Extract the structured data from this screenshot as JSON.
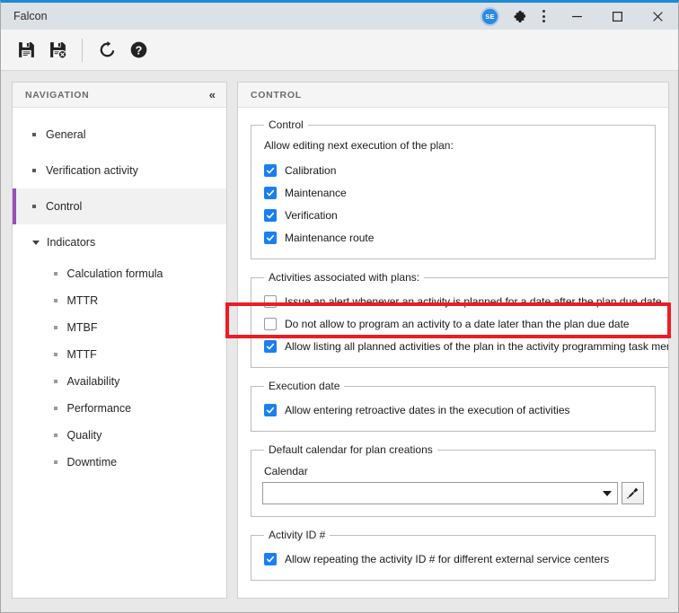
{
  "window": {
    "title": "Falcon",
    "avatar_initials": "SE",
    "accent_top": "#1c8ad4",
    "controls": {
      "minimize": "Minimize",
      "maximize": "Maximize",
      "close": "Close"
    },
    "extensions_icon": "puzzle-piece-icon",
    "menu_icon": "kebab-menu-icon"
  },
  "toolbar": {
    "items": [
      {
        "name": "save-button",
        "icon": "floppy-disk-icon",
        "tooltip": "Save"
      },
      {
        "name": "save-and-close-button",
        "icon": "floppy-disk-close-icon",
        "tooltip": "Save and close"
      },
      {
        "name": "refresh-button",
        "icon": "refresh-icon",
        "tooltip": "Refresh"
      },
      {
        "name": "help-button",
        "icon": "question-circle-icon",
        "tooltip": "Help"
      }
    ]
  },
  "sidebar": {
    "header": "NAVIGATION",
    "collapse_icon": "double-chevron-left-icon",
    "items": [
      {
        "label": "General",
        "type": "item",
        "selected": false
      },
      {
        "label": "Verification activity",
        "type": "item",
        "selected": false
      },
      {
        "label": "Control",
        "type": "item",
        "selected": true
      },
      {
        "label": "Indicators",
        "type": "group",
        "expanded": true
      }
    ],
    "sub_items": [
      {
        "label": "Calculation formula"
      },
      {
        "label": "MTTR"
      },
      {
        "label": "MTBF"
      },
      {
        "label": "MTTF"
      },
      {
        "label": "Availability"
      },
      {
        "label": "Performance"
      },
      {
        "label": "Quality"
      },
      {
        "label": "Downtime"
      }
    ],
    "selected_accent": "#9651b8"
  },
  "main": {
    "header": "CONTROL",
    "checkbox_accent": "#1a7ff0",
    "groups": [
      {
        "legend": "Control",
        "hint": "Allow editing next execution of the plan:",
        "checkboxes": [
          {
            "label": "Calibration",
            "checked": true
          },
          {
            "label": "Maintenance",
            "checked": true
          },
          {
            "label": "Verification",
            "checked": true
          },
          {
            "label": "Maintenance route",
            "checked": true
          }
        ]
      },
      {
        "legend": "Activities associated with plans:",
        "checkboxes": [
          {
            "label": "Issue an alert whenever an activity is planned for a date after the plan due date",
            "checked": false
          },
          {
            "label": "Do not allow to program an activity to a date later than the plan due date",
            "checked": false
          },
          {
            "label": "Allow listing all planned activities of the plan in the activity programming task menu.",
            "checked": true
          }
        ]
      },
      {
        "legend": "Execution date",
        "checkboxes": [
          {
            "label": "Allow entering retroactive dates in the execution of activities",
            "checked": true
          }
        ]
      },
      {
        "legend": "Default calendar for plan creations",
        "field_label": "Calendar",
        "select_value": "",
        "select_caret_icon": "chevron-down-icon",
        "clear_button_icon": "brush-icon"
      },
      {
        "legend": "Activity ID #",
        "checkboxes": [
          {
            "label": "Allow repeating the activity ID # for different external service centers",
            "checked": true
          }
        ]
      }
    ]
  },
  "highlight": {
    "color": "#ed1c24",
    "target": "Allow listing all planned activities of the plan in the activity programming task menu."
  }
}
